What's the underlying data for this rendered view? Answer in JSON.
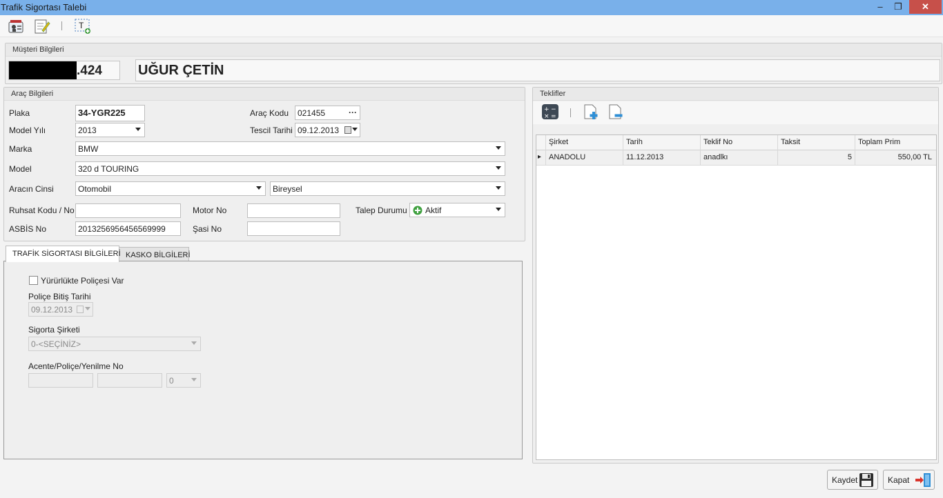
{
  "window": {
    "title": "Trafik Sigortası Talebi",
    "minimize": "–",
    "maximize": "❐",
    "close": "✕"
  },
  "customer": {
    "section": "Müşteri Bilgileri",
    "id_suffix": ".424",
    "name": "UĞUR ÇETİN"
  },
  "vehicle": {
    "section": "Araç Bilgileri",
    "plaka_label": "Plaka",
    "plaka": "34-YGR225",
    "arac_kodu_label": "Araç Kodu",
    "arac_kodu": "021455",
    "arac_kodu_btn": "···",
    "model_yili_label": "Model Yılı",
    "model_yili": "2013",
    "tescil_label": "Tescil Tarihi",
    "tescil": "09.12.2013",
    "marka_label": "Marka",
    "marka": "BMW",
    "model_label": "Model",
    "model": "320 d TOURING",
    "cins_label": "Aracın Cinsi",
    "cins": "Otomobil",
    "kullanim": "Bireysel",
    "ruhsat_label": "Ruhsat Kodu / No",
    "ruhsat": "",
    "motor_label": "Motor No",
    "motor": "",
    "talep_label": "Talep Durumu",
    "talep": "Aktif",
    "asbis_label": "ASBİS No",
    "asbis": "2013256956456569999",
    "sasi_label": "Şasi No",
    "sasi": ""
  },
  "tabs": {
    "traffic": "TRAFİK SİGORTASI BİLGİLERİ",
    "kasko": "KASKO BİLGİLERİ"
  },
  "traffic": {
    "policy_check": "Yürürlükte Poliçesi Var",
    "end_label": "Poliçe Bitiş Tarihi",
    "end_date": "09.12.2013",
    "company_label": "Sigorta Şirketi",
    "company": "0-<SEÇİNİZ>",
    "agency_label": "Acente/Poliçe/Yenilme No",
    "renewal": "0"
  },
  "offers": {
    "section": "Teklifler",
    "columns": [
      "Şirket",
      "Tarih",
      "Teklif No",
      "Taksit",
      "Toplam Prim"
    ],
    "rows": [
      {
        "sirket": "ANADOLU",
        "tarih": "11.12.2013",
        "teklif_no": "anadlkı",
        "taksit": "5",
        "prim": "550,00 TL"
      }
    ],
    "row_marker": "▸"
  },
  "buttons": {
    "save": "Kaydet",
    "close": "Kapat"
  }
}
